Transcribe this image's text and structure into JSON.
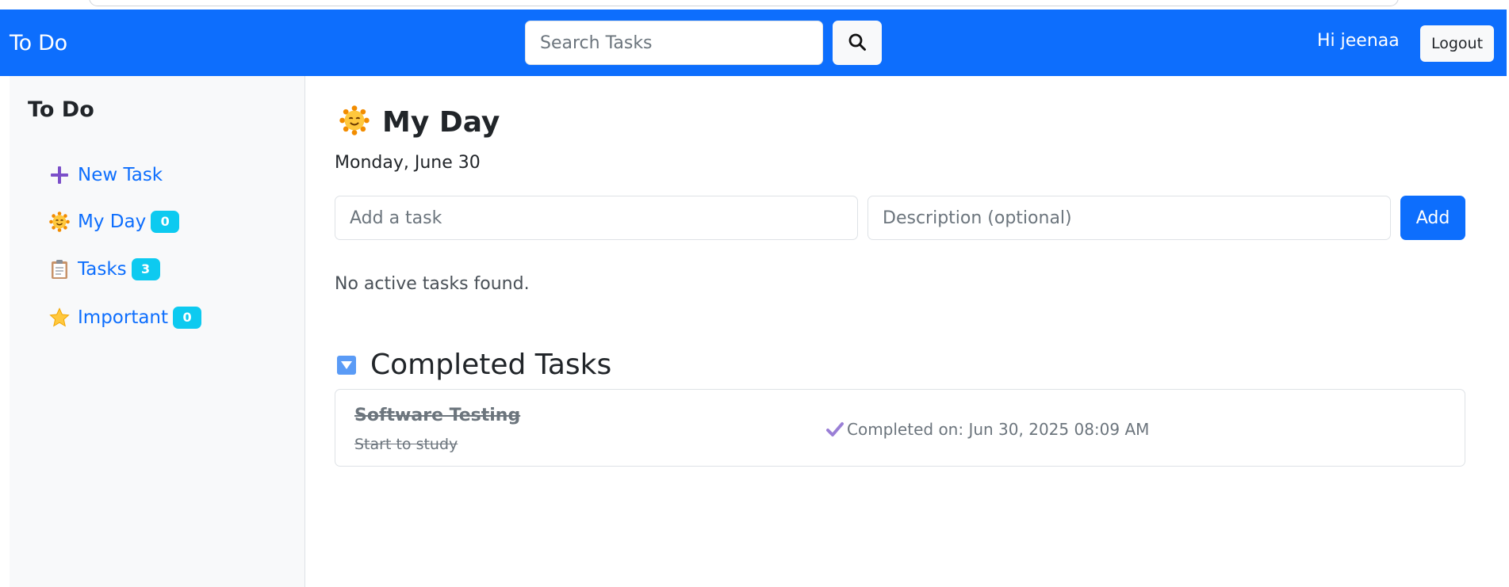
{
  "navbar": {
    "brand": "To Do",
    "search_placeholder": "Search Tasks",
    "search_icon": "search-icon",
    "greeting": "Hi jeenaa",
    "logout_label": "Logout",
    "color": "#0d6efd"
  },
  "sidebar": {
    "title": "To Do",
    "items": [
      {
        "label": "New Task",
        "icon": "plus-icon"
      },
      {
        "label": "My Day",
        "icon": "smiling-sun-icon",
        "badge": "0"
      },
      {
        "label": "Tasks",
        "icon": "clipboard-icon",
        "badge": "3"
      },
      {
        "label": "Important",
        "icon": "star-icon",
        "badge": "0"
      }
    ],
    "badge_color": "#0dcaf0"
  },
  "main": {
    "title": "My Day",
    "title_icon": "smiling-sun-icon",
    "date": "Monday, June 30",
    "task_placeholder": "Add a task",
    "description_placeholder": "Description (optional)",
    "add_label": "Add",
    "empty_message": "No active tasks found.",
    "completed": {
      "heading": "Completed Tasks",
      "toggle_icon": "triangle-down-icon",
      "tasks": [
        {
          "title": "Software Testing",
          "description": "Start to study",
          "completed_text": "Completed on: Jun 30, 2025 08:09 AM",
          "check_icon": "check-icon"
        }
      ]
    }
  }
}
